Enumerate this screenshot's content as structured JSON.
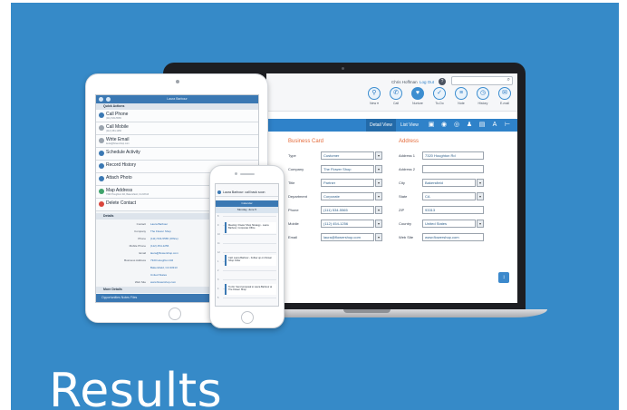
{
  "heading": "Results",
  "colors": {
    "background": "#368ac8",
    "accent": "#2f82c9",
    "section_title": "#e46a3a"
  },
  "laptop": {
    "topbar": {
      "user": "Chris Hoffman",
      "logout": "Log Out",
      "help_icon": "help-icon",
      "search_placeholder": ""
    },
    "toolbar": [
      {
        "icon": "user-plus-icon",
        "label": "New ▾"
      },
      {
        "icon": "phone-icon",
        "label": "Call"
      },
      {
        "icon": "heart-icon",
        "label": "Nurture"
      },
      {
        "icon": "task-icon",
        "label": "To-Do"
      },
      {
        "icon": "note-icon",
        "label": "Note"
      },
      {
        "icon": "history-icon",
        "label": "History"
      },
      {
        "icon": "email-icon",
        "label": "E-mail"
      }
    ],
    "view_tabs": {
      "detail": "Detail View",
      "list": "List View"
    },
    "business_card": {
      "title": "Business Card",
      "fields": [
        {
          "label": "Type",
          "value": "Customer",
          "dropdown": true
        },
        {
          "label": "Company",
          "value": "The Flower Shop",
          "dropdown": true
        },
        {
          "label": "Title",
          "value": "Partner",
          "dropdown": true
        },
        {
          "label": "Department",
          "value": "Corporate",
          "dropdown": true
        },
        {
          "label": "Phone",
          "value": "(111) 534-5565",
          "dropdown": true
        },
        {
          "label": "Mobile",
          "value": "(112) 454-1256",
          "dropdown": true
        },
        {
          "label": "Email",
          "value": "laura@flowershop.com",
          "dropdown": true
        }
      ]
    },
    "address": {
      "title": "Address",
      "fields": [
        {
          "label": "Address 1",
          "value": "7320 Houghton Rd",
          "dropdown": false
        },
        {
          "label": "Address 2",
          "value": "",
          "dropdown": false
        },
        {
          "label": "City",
          "value": "Bakersfield",
          "dropdown": true
        },
        {
          "label": "State",
          "value": "CA",
          "dropdown": true
        },
        {
          "label": "ZIP",
          "value": "93313",
          "dropdown": false
        },
        {
          "label": "Country",
          "value": "United States",
          "dropdown": true
        },
        {
          "label": "Web Site",
          "value": "www.flowershop.com",
          "dropdown": false
        }
      ]
    }
  },
  "tablet": {
    "header_title": "Laura Barbour",
    "quick_actions_label": "Quick Actions",
    "actions": [
      {
        "icon": "phone-icon",
        "title": "Call Phone",
        "sub": "(111) 534-5565",
        "color": "#3a78b3"
      },
      {
        "icon": "mobile-icon",
        "title": "Call Mobile",
        "sub": "(112) 454-1256",
        "color": "#9aa3ad"
      },
      {
        "icon": "email-icon",
        "title": "Write Email",
        "sub": "laura@flowershop.com",
        "color": "#9aa3ad"
      },
      {
        "icon": "calendar-icon",
        "title": "Schedule Activity",
        "sub": "",
        "color": "#3a78b3"
      },
      {
        "icon": "history-icon",
        "title": "Record History",
        "sub": "",
        "color": "#3a78b3"
      },
      {
        "icon": "camera-icon",
        "title": "Attach Photo",
        "sub": "",
        "color": "#3a78b3"
      },
      {
        "icon": "map-icon",
        "title": "Map Address",
        "sub": "7320 Houghton Rd, Bakersfield, CA 93313",
        "color": "#3fa36b"
      },
      {
        "icon": "delete-icon",
        "title": "Delete Contact",
        "sub": "",
        "color": "#d9453c"
      }
    ],
    "details_label": "Details",
    "details": [
      {
        "label": "Contact",
        "value": "Laura Barbour"
      },
      {
        "label": "Company",
        "value": "The Flower Shop"
      },
      {
        "label": "Phone",
        "value": "(111) 534-5565 (Office)"
      },
      {
        "label": "Mobile Phone",
        "value": "(112) 454-1256"
      },
      {
        "label": "Email",
        "value": "laura@flowershop.com"
      },
      {
        "label": "Business Address",
        "value": "7320 Houghton Rd"
      },
      {
        "label": "",
        "value": "Bakersfield, CA 93313"
      },
      {
        "label": "",
        "value": "United States"
      },
      {
        "label": "Web Site",
        "value": "www.flowershop.com"
      }
    ],
    "more_label": "More Details",
    "footer": "Opportunities  Notes  Files"
  },
  "phone": {
    "alert": "Laura Barbour: call back soon",
    "calendar_title": "Calendar",
    "day_label": "Monday, June 5",
    "hours": [
      "8",
      "9",
      "10",
      "11",
      "12",
      "1",
      "2",
      "3",
      "4",
      "5"
    ],
    "events": [
      {
        "text": "Meeting: Flower Shop Strategy - Laura Barbour, Corporate Office"
      },
      {
        "text": "Call: Laura Barbour - Follow up on Flower Shop Order"
      },
      {
        "text": "To-Do: Send proposal to Laura Barbour at The Flower Shop"
      }
    ]
  }
}
